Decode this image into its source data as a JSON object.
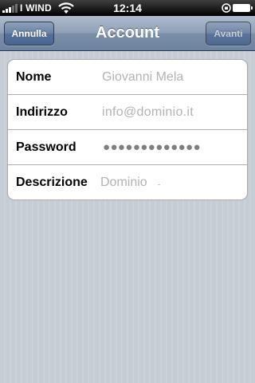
{
  "status_bar": {
    "carrier": "I WIND",
    "time": "12:14",
    "icons": [
      "signal-strength-icon",
      "wifi-icon",
      "orientation-lock-icon",
      "battery-icon"
    ]
  },
  "nav_bar": {
    "title": "Account",
    "cancel_label": "Annulla",
    "next_label": "Avanti",
    "next_enabled": false
  },
  "form": {
    "rows": [
      {
        "label": "Nome",
        "value": "Giovanni Mela",
        "is_placeholder": true
      },
      {
        "label": "Indirizzo",
        "value": "info@dominio.it",
        "is_placeholder": true
      },
      {
        "label": "Password",
        "value": "●●●●●●●●●●●●●",
        "is_placeholder": false
      },
      {
        "label": "Descrizione",
        "value": "Dominio",
        "is_placeholder": true
      }
    ]
  },
  "colors": {
    "nav_bar": "#7b8fa8",
    "background": "#c5ccd4",
    "placeholder_text": "#b3b3b3",
    "password_dots": "#7f7f7f"
  }
}
